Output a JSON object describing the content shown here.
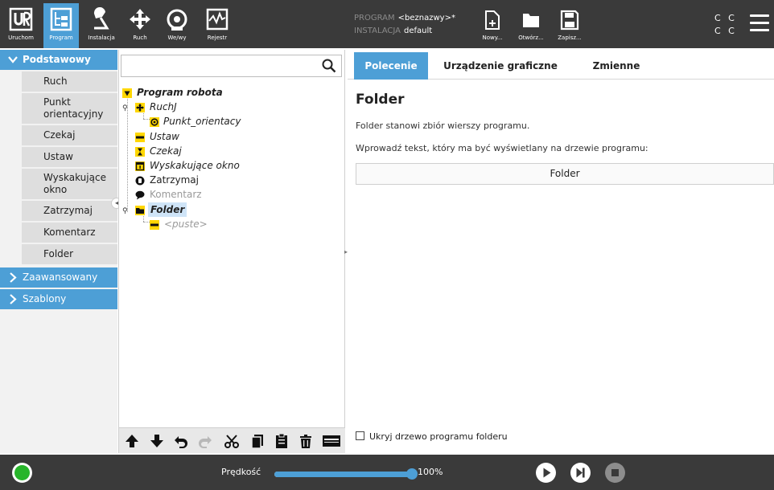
{
  "header": {
    "tabs": [
      {
        "label": "Uruchom",
        "icon": "ur-logo-icon"
      },
      {
        "label": "Program",
        "icon": "program-icon",
        "active": true
      },
      {
        "label": "Instalacja",
        "icon": "installation-icon"
      },
      {
        "label": "Ruch",
        "icon": "move-icon"
      },
      {
        "label": "We/wy",
        "icon": "io-icon"
      },
      {
        "label": "Rejestr",
        "icon": "log-icon"
      }
    ],
    "program_key": "PROGRAM",
    "program_value": "<beznazwy>*",
    "installation_key": "INSTALACJA",
    "installation_value": "default",
    "file_buttons": [
      {
        "label": "Nowy...",
        "icon": "new-file-icon"
      },
      {
        "label": "Otwórz...",
        "icon": "open-folder-icon"
      },
      {
        "label": "Zapisz...",
        "icon": "save-icon"
      }
    ],
    "cc_row1": "C C",
    "cc_row2": "C C"
  },
  "palette": {
    "categories": [
      "Podstawowy",
      "Zaawansowany",
      "Szablony"
    ],
    "items": [
      "Ruch",
      "Punkt orientacyjny",
      "Czekaj",
      "Ustaw",
      "Wyskakujące okno",
      "Zatrzymaj",
      "Komentarz",
      "Folder"
    ]
  },
  "tree": {
    "search_placeholder": "",
    "nodes": [
      {
        "label": "Program robota",
        "icon": "program-root-icon"
      },
      {
        "label": "RuchJ",
        "icon": "move-node-icon"
      },
      {
        "label": "Punkt_orientacy",
        "icon": "waypoint-icon"
      },
      {
        "label": "Ustaw",
        "icon": "set-icon"
      },
      {
        "label": "Czekaj",
        "icon": "hourglass-icon"
      },
      {
        "label": "Wyskakujące okno",
        "icon": "popup-icon"
      },
      {
        "label": "Zatrzymaj",
        "icon": "stop-hand-icon"
      },
      {
        "label": "Komentarz",
        "icon": "comment-icon"
      },
      {
        "label": "Folder",
        "icon": "folder-icon",
        "selected": true
      },
      {
        "label": "<puste>",
        "icon": "empty-icon"
      }
    ]
  },
  "right": {
    "tabs": [
      "Polecenie",
      "Urządzenie graficzne",
      "Zmienne"
    ],
    "title": "Folder",
    "description": "Folder stanowi zbiór wierszy programu.",
    "instruction": "Wprowadź tekst, który ma być wyświetlany na drzewie programu:",
    "folder_name": "Folder",
    "hide_label": "Ukryj drzewo programu folderu"
  },
  "footer": {
    "speed_label": "Prędkość",
    "speed_value": "100%",
    "speed_fraction": 1.0
  },
  "colors": {
    "accent": "#4d9fd6",
    "header_bg": "#3a3a3a",
    "power_on": "#27b52a",
    "tree_yellow": "#ffd700"
  }
}
